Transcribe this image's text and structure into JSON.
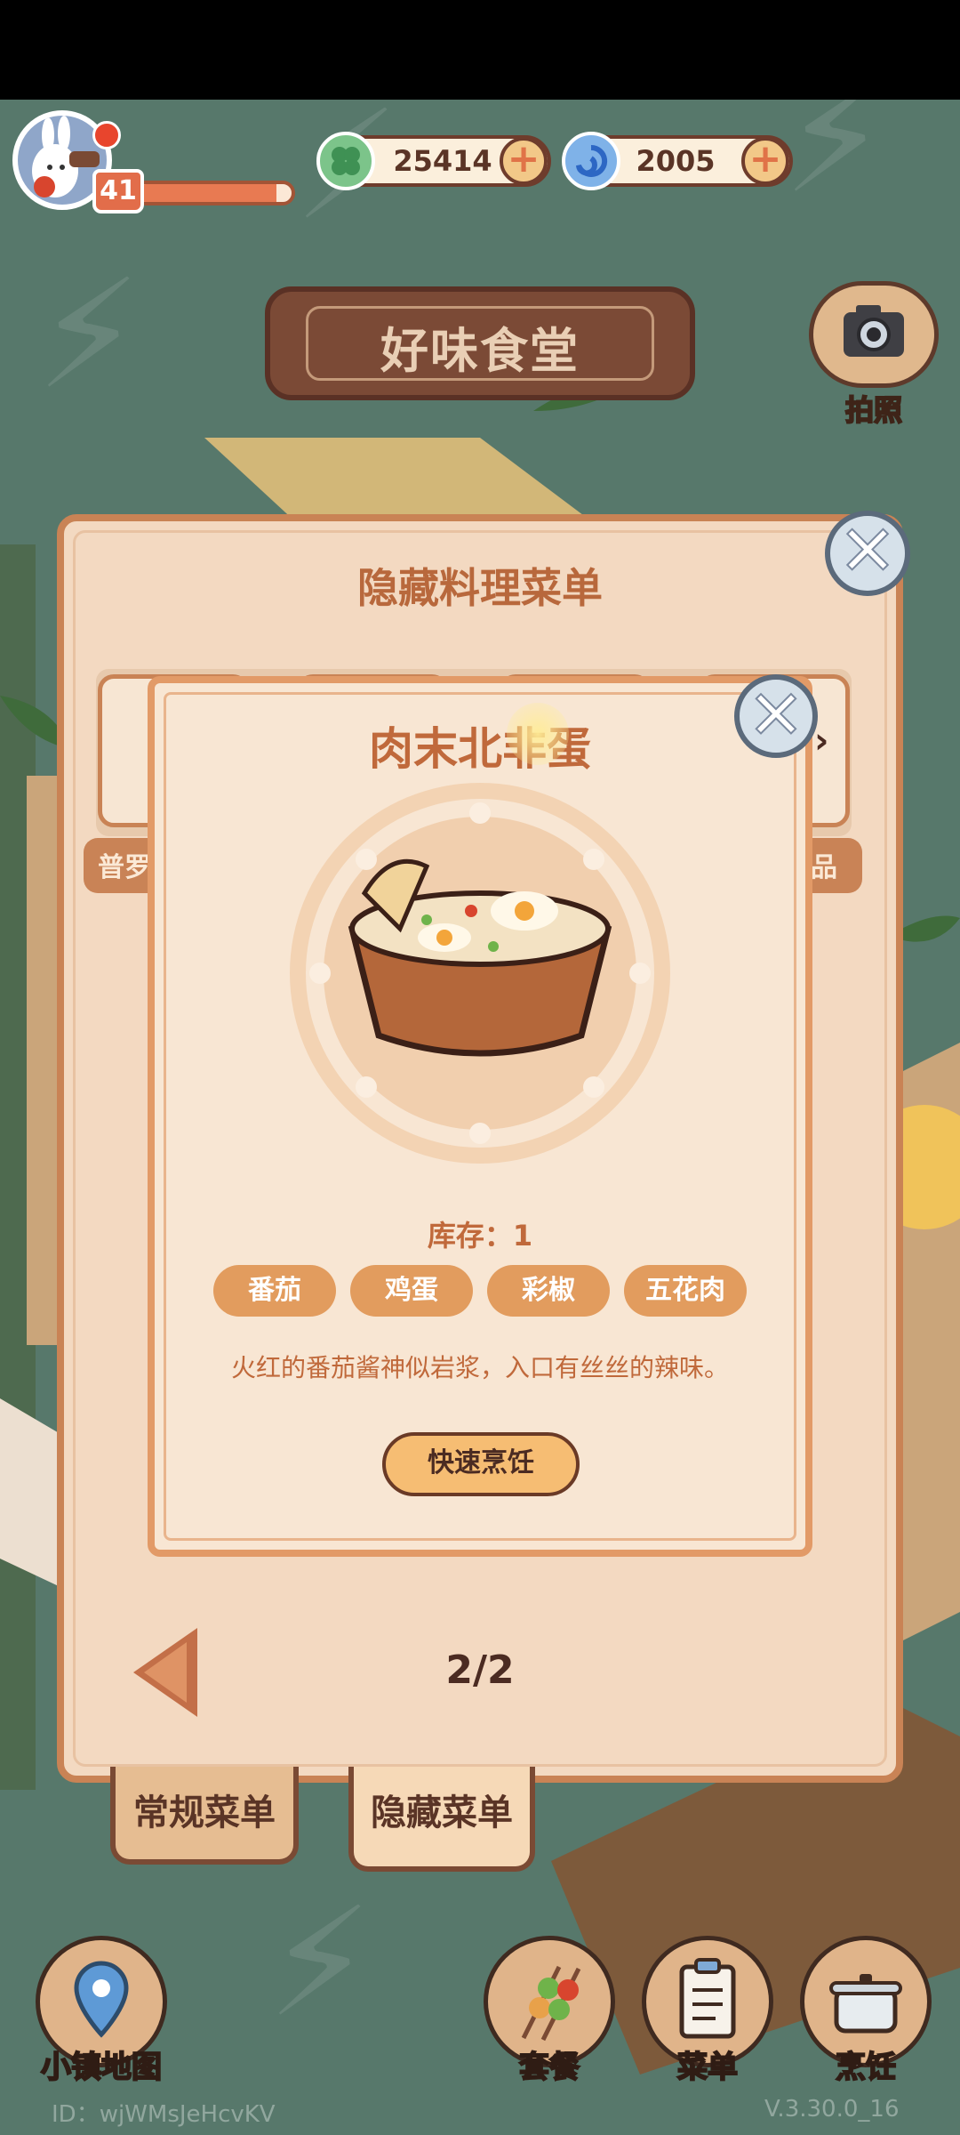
{
  "hud": {
    "level": "41",
    "xp_fraction": 0.9,
    "clover_coins": "25414",
    "swirl_gems": "2005",
    "plus_label": "+"
  },
  "restaurant": {
    "title": "好味食堂"
  },
  "camera": {
    "label": "拍照",
    "icon": "camera-icon"
  },
  "hidden_menu_panel": {
    "title": "隐藏料理菜单",
    "close_symbol": "✕",
    "item_name_left": "普罗",
    "item_name_right": "品",
    "page_indicator": "2/2",
    "tabs": [
      {
        "label": "常规菜单"
      },
      {
        "label": "隐藏菜单"
      }
    ]
  },
  "recipe_popup": {
    "dish_name": "肉末北非蛋",
    "close_symbol": "✕",
    "stock_text": "库存：1",
    "ingredients": [
      "番茄",
      "鸡蛋",
      "彩椒",
      "五花肉"
    ],
    "description": "火红的番茄酱神似岩浆，入口有丝丝的辣味。",
    "quick_cook_label": "快速烹饪",
    "dish_icon": "bowl-icon"
  },
  "bottom_bar": {
    "town_map": "小镇地图",
    "set_meal": "套餐",
    "menu": "菜单",
    "cook": "烹饪"
  },
  "footer": {
    "user_id": "ID：wjWMsJeHcvKV",
    "version": "V.3.30.0_16"
  },
  "colors": {
    "background": "#57786b",
    "panel": "#f3d9c1",
    "accent": "#c0693b",
    "ingredient_chip": "#e29c5e"
  }
}
